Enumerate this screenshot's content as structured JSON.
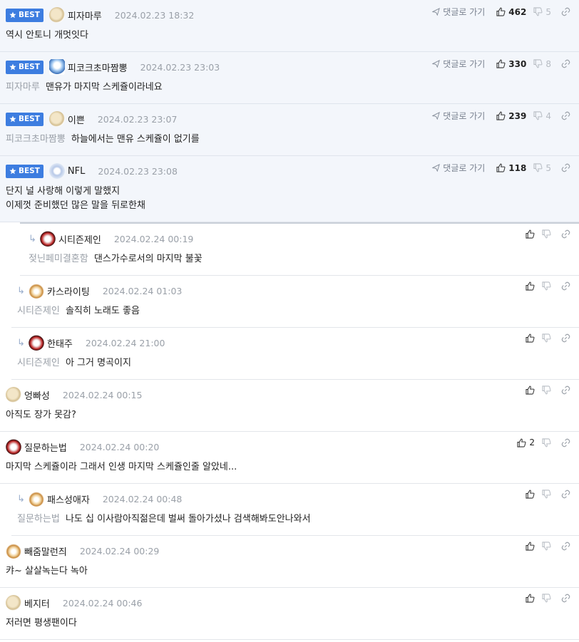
{
  "labels": {
    "best": "BEST",
    "goto": "댓글로 가기"
  },
  "comments": [
    {
      "nick": "피자마루",
      "date": "2024.02.23 18:32",
      "text": "역시 안토니 개멋잇다",
      "mention": "",
      "up": "462",
      "down": "5",
      "avatar": "cream-dog",
      "best": true
    },
    {
      "nick": "피코크초마짬뽕",
      "date": "2024.02.23 23:03",
      "mention": "피자마루",
      "text": "맨유가 마지막 스케쥴이라네요",
      "up": "330",
      "down": "8",
      "avatar": "blue-character",
      "best": true
    },
    {
      "nick": "이쁜",
      "date": "2024.02.23 23:07",
      "mention": "피코크초마짬뽕",
      "text": "하늘에서는 맨유 스케쥴이 없기를",
      "up": "239",
      "down": "4",
      "avatar": "cream-dog",
      "best": true
    },
    {
      "nick": "NFL",
      "date": "2024.02.23 23:08",
      "mention": "",
      "text_lines": [
        "단지 널 사랑해 이렇게 말했지",
        "이제껏 준비했던 많은 말을 뒤로한채"
      ],
      "up": "118",
      "down": "5",
      "avatar": "white-bear",
      "best": true
    },
    {
      "nick": "시티즌제인",
      "date": "2024.02.24 00:19",
      "mention": "젖닌페미결혼함",
      "text": "댄스가수로서의 마지막 불꽃",
      "avatar": "red-pup"
    },
    {
      "nick": "카스라이팅",
      "date": "2024.02.24 01:03",
      "mention": "시티즌제인",
      "text": "솔직히 노래도 좋음",
      "avatar": "fox-pup"
    },
    {
      "nick": "한태주",
      "date": "2024.02.24 21:00",
      "mention": "시티즌제인",
      "text": "아 그거 명곡이지",
      "avatar": "red-pup"
    },
    {
      "nick": "엉빠성",
      "date": "2024.02.24 00:15",
      "mention": "",
      "text": "아직도 장가 못감?",
      "avatar": "cream-dog"
    },
    {
      "nick": "질문하는법",
      "date": "2024.02.24 00:20",
      "mention": "",
      "text": "마지막 스케쥴이라 그래서 인생 마지막 스케쥴인줄 알았네...",
      "up": "2",
      "avatar": "red-pup"
    },
    {
      "nick": "패스성애자",
      "date": "2024.02.24 00:48",
      "mention": "질문하는법",
      "text": "나도 십 이사람아직젊은데 벌써 돌아가셨나 검색해봐도안나와서",
      "avatar": "fox-pup"
    },
    {
      "nick": "빼줌말런즤",
      "date": "2024.02.24 00:29",
      "mention": "",
      "text": "캬~ 살살녹는다 녹아",
      "avatar": "fox-pup"
    },
    {
      "nick": "베지터",
      "date": "2024.02.24 00:46",
      "mention": "",
      "text": "저러면 평생팬이다",
      "avatar": "cream-dog"
    }
  ]
}
